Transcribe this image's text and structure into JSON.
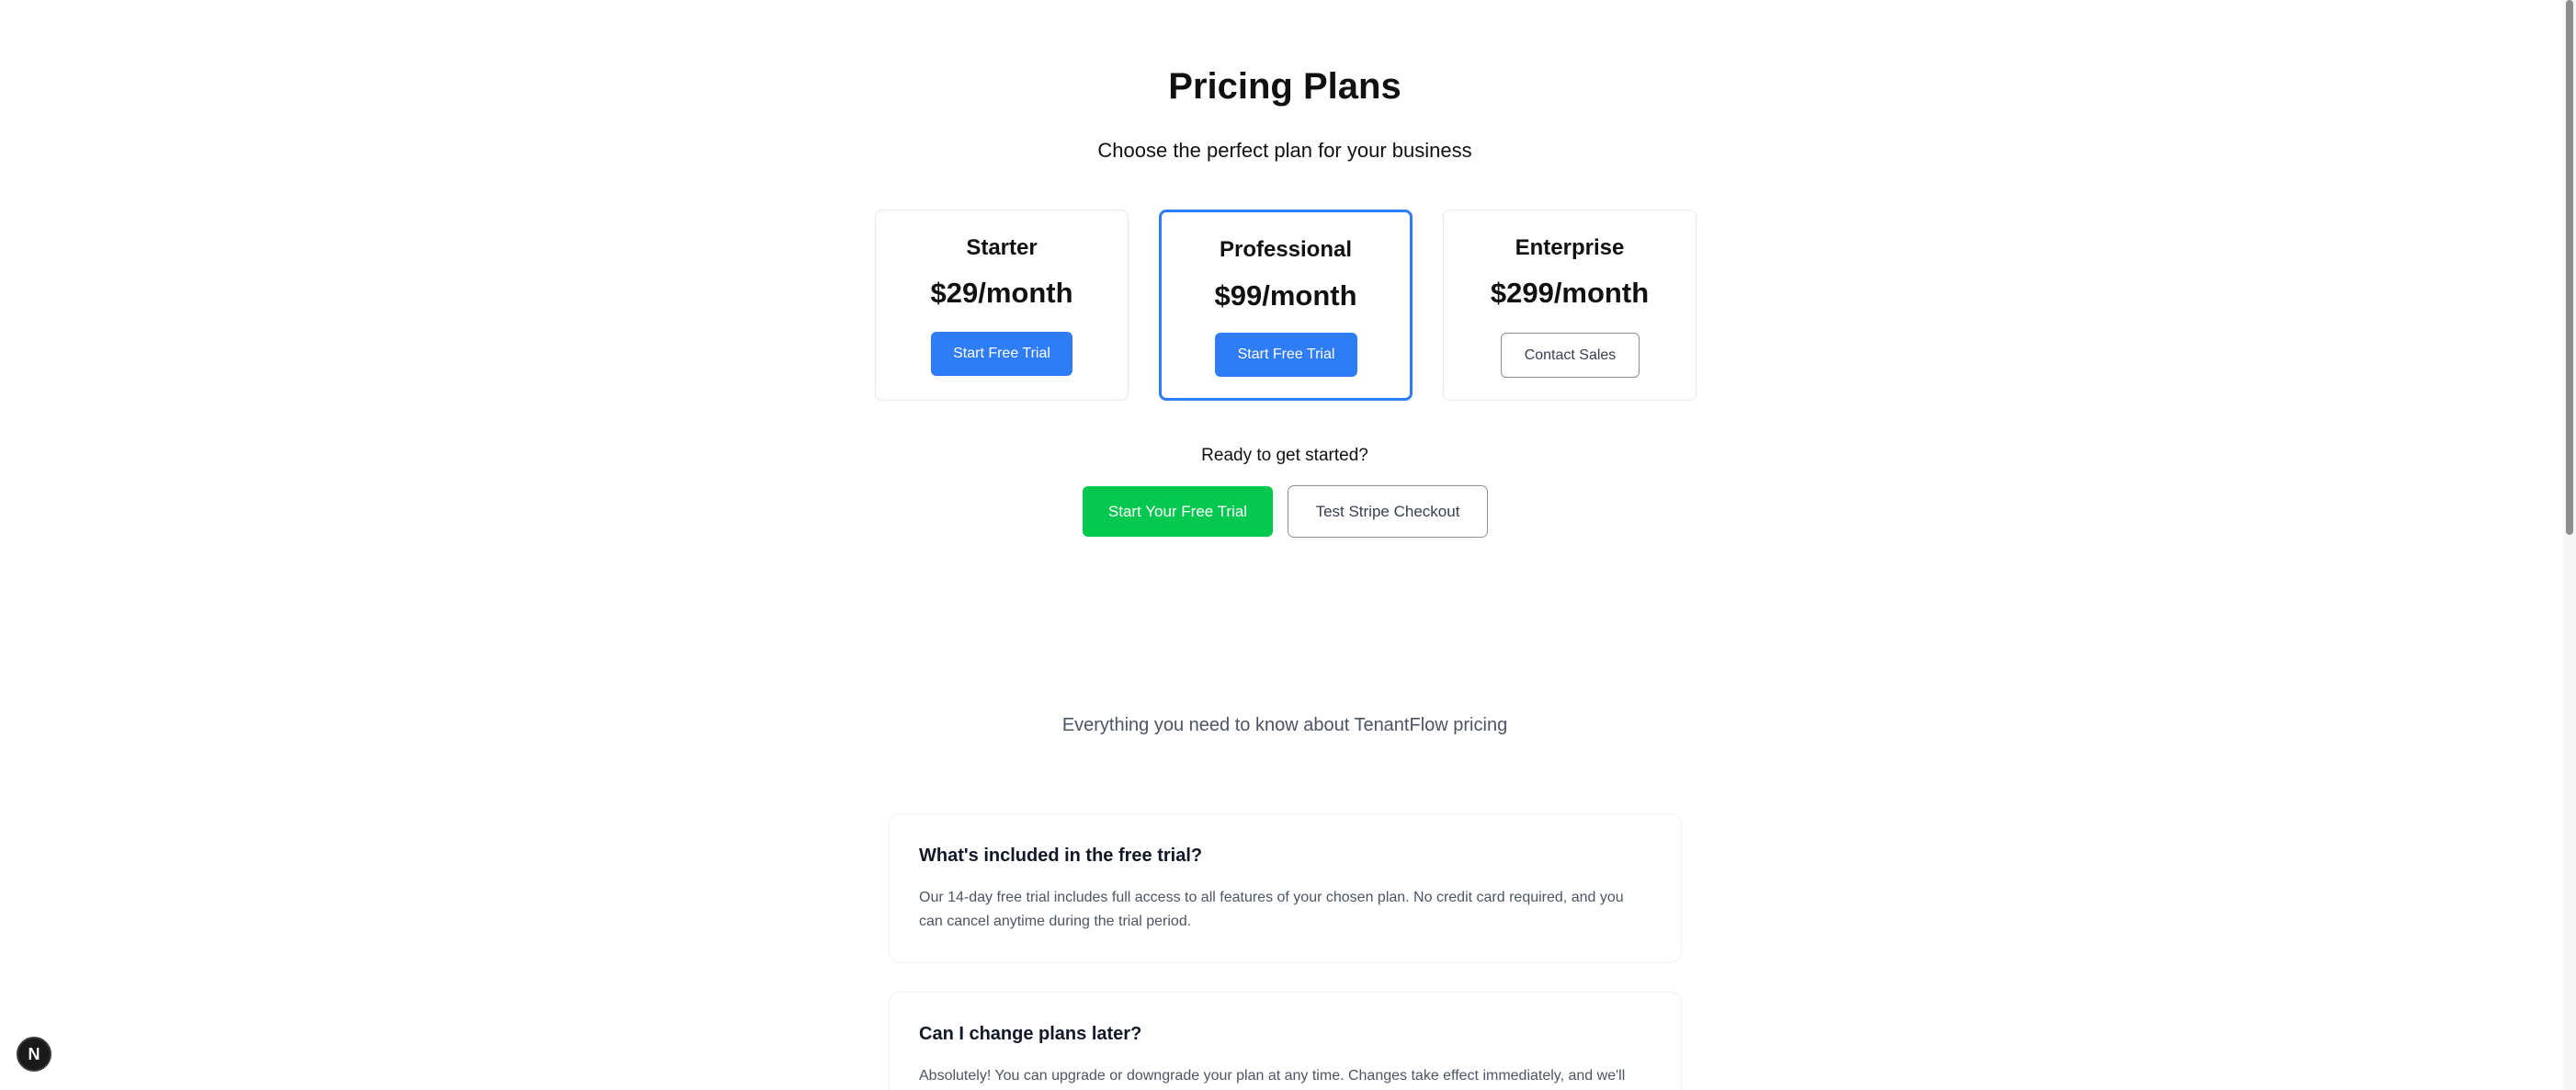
{
  "header": {
    "title": "Pricing Plans",
    "subtitle": "Choose the perfect plan for your business"
  },
  "plans": [
    {
      "name": "Starter",
      "price": "$29/month",
      "button_label": "Start Free Trial",
      "featured": false
    },
    {
      "name": "Professional",
      "price": "$99/month",
      "button_label": "Start Free Trial",
      "featured": true
    },
    {
      "name": "Enterprise",
      "price": "$299/month",
      "button_label": "Contact Sales",
      "featured": false
    }
  ],
  "cta": {
    "prompt": "Ready to get started?",
    "primary_label": "Start Your Free Trial",
    "secondary_label": "Test Stripe Checkout"
  },
  "faq": {
    "intro": "Everything you need to know about TenantFlow pricing",
    "items": [
      {
        "question": "What's included in the free trial?",
        "answer": "Our 14-day free trial includes full access to all features of your chosen plan. No credit card required, and you can cancel anytime during the trial period."
      },
      {
        "question": "Can I change plans later?",
        "answer": "Absolutely! You can upgrade or downgrade your plan at any time. Changes take effect immediately, and we'll"
      }
    ]
  },
  "devtools": {
    "badge_letter": "N",
    "icon": "nextjs-icon"
  },
  "colors": {
    "accent_blue": "#2f7df6",
    "accent_green": "#05c850",
    "border_gray": "#8b8f96"
  }
}
